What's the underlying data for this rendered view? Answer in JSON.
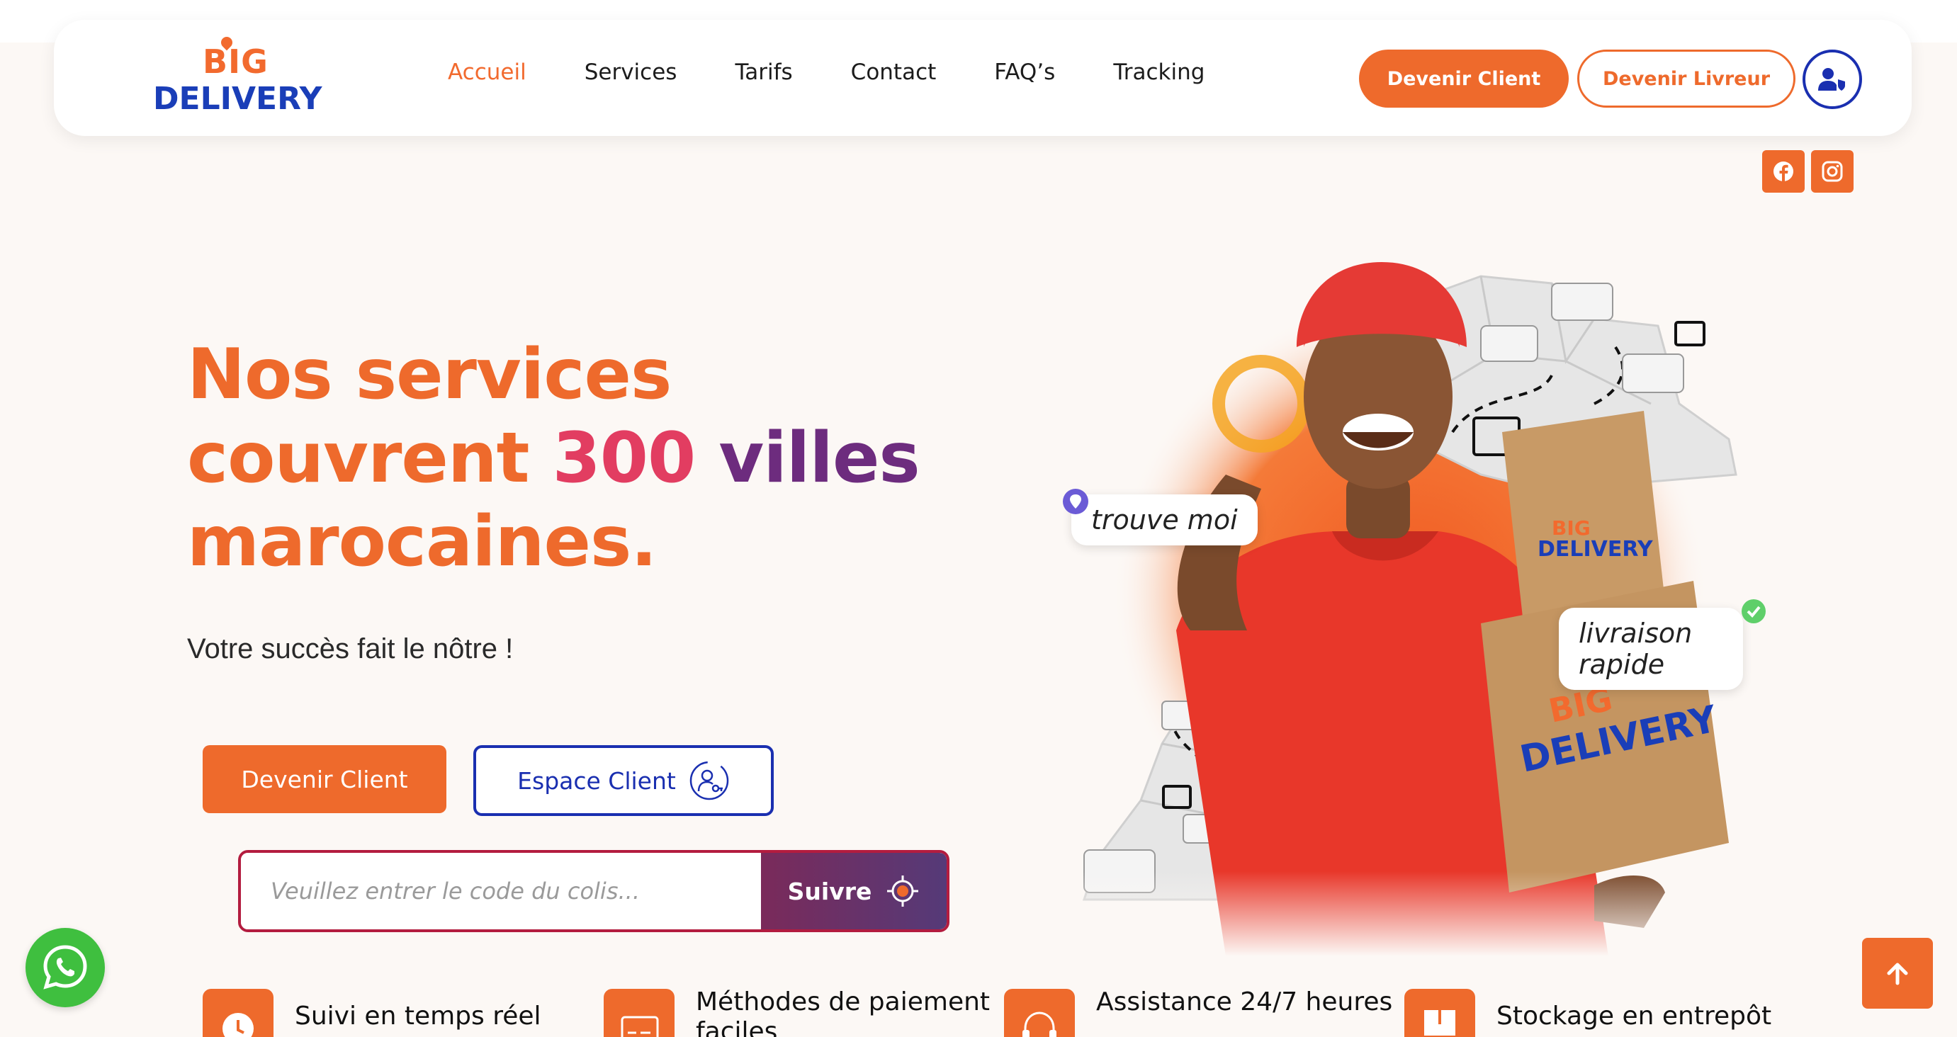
{
  "brand": {
    "logo_top": "BIG",
    "logo_bottom": "DELIVERY"
  },
  "nav": {
    "links": [
      "Accueil",
      "Services",
      "Tarifs",
      "Contact",
      "FAQ’s",
      "Tracking"
    ],
    "active": "Accueil",
    "client_btn": "Devenir Client",
    "livreur_btn": "Devenir Livreur",
    "user_icon": "user-shield-icon"
  },
  "social": {
    "facebook_icon": "facebook-icon",
    "instagram_icon": "instagram-icon"
  },
  "hero": {
    "line1": "Nos services",
    "line2_a": "couvrent",
    "line2_num": "300",
    "line2_b": "villes",
    "line3": "marocaines.",
    "subtitle": "Votre succès fait le nôtre !",
    "btn_devenir": "Devenir Client",
    "btn_espace": "Espace Client",
    "track_placeholder": "Veuillez entrer le code du colis...",
    "track_btn": "Suivre",
    "bubble_1": "trouve moi",
    "bubble_2": "livraison rapide",
    "box_big": "BIG",
    "box_delivery": "DELIVERY"
  },
  "features": [
    {
      "label": "Suivi en temps réel",
      "icon": "clock-icon"
    },
    {
      "label": "Méthodes de paiement faciles",
      "icon": "payment-card-icon"
    },
    {
      "label": "Assistance 24/7 heures",
      "icon": "headset-icon"
    },
    {
      "label": "Stockage en entrepôt",
      "icon": "box-storage-icon"
    }
  ],
  "colors": {
    "primary": "#ee6a2c",
    "blue": "#1a2fb0",
    "pink": "#e23d61",
    "purple": "#6d2c7e"
  }
}
